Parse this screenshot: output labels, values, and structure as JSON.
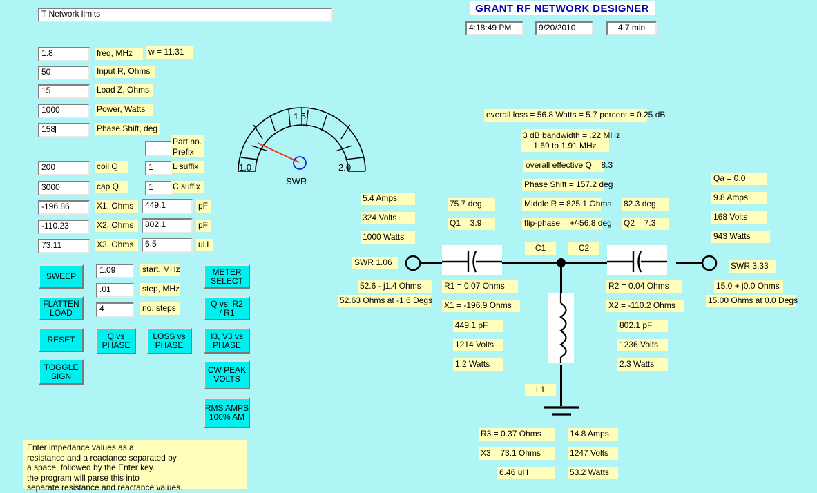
{
  "header": {
    "title": "GRANT RF NETWORK DESIGNER",
    "time": "4:18:49 PM",
    "date": "9/20/2010",
    "elapsed": "4.7 min"
  },
  "top_field": {
    "value": "T Network limits"
  },
  "inputs": [
    {
      "name": "freq",
      "value": "1.8",
      "label": "freq, MHz"
    },
    {
      "name": "input_r",
      "value": "50",
      "label": "Input R, Ohms"
    },
    {
      "name": "load_z",
      "value": "15",
      "label": "Load Z, Ohms"
    },
    {
      "name": "power",
      "value": "1000",
      "label": "Power, Watts"
    },
    {
      "name": "phase_shift",
      "value": "158",
      "label": "Phase Shift, deg"
    },
    {
      "name": "coil_q",
      "value": "200",
      "label": "coil Q"
    },
    {
      "name": "cap_q",
      "value": "3000",
      "label": "cap Q"
    },
    {
      "name": "x1",
      "value": "-196.86",
      "label": "X1, Ohms"
    },
    {
      "name": "x2",
      "value": "-110.23",
      "label": "X2, Ohms"
    },
    {
      "name": "x3",
      "value": "73.11",
      "label": "X3, Ohms"
    }
  ],
  "w_label": "w = 11.31",
  "part": {
    "prefix_value": "",
    "prefix_label": "Part no.\nPrefix",
    "l_suffix_value": "1",
    "l_suffix_label": "L suffix",
    "c_suffix_value": "1",
    "c_suffix_label": "C suffix"
  },
  "component_values": [
    {
      "name": "c1_pf",
      "value": "449.1",
      "unit": "pF"
    },
    {
      "name": "c2_pf",
      "value": "802.1",
      "unit": "pF"
    },
    {
      "name": "l1_uh",
      "value": "6.5",
      "unit": "uH"
    }
  ],
  "sweep": {
    "start_value": "1.09",
    "start_label": "start, MHz",
    "step_value": ".01",
    "step_label": "step, MHz",
    "steps_value": "4",
    "steps_label": "no. steps"
  },
  "buttons": {
    "sweep": "SWEEP",
    "flatten_load": "FLATTEN\nLOAD",
    "reset": "RESET",
    "toggle_sign": "TOGGLE\nSIGN",
    "q_vs_phase": "Q vs\nPHASE",
    "loss_vs_phase": "LOSS vs\nPHASE",
    "meter_select": "METER\nSELECT",
    "q_vs_r2_r1": "Q vs  R2\n/ R1",
    "i3_v3_vs_phase": "I3, V3 vs\nPHASE",
    "cw_peak_volts": "CW PEAK\nVOLTS",
    "rms_amps": "RMS AMPS\n100% AM"
  },
  "meter": {
    "label": "SWR",
    "tick_low": "1.0",
    "tick_mid": "1.5",
    "tick_high": "2.0",
    "needle_value": 1.03,
    "needle_color": "#ff3000",
    "hub_color": "#2020d0"
  },
  "results": {
    "overall_loss": "overall loss = 56.8 Watts = 5.7 percent = 0.25 dB",
    "bandwidth": "3 dB bandwidth = .22 MHz\n1.69 to 1.91 MHz",
    "effective_q": "overall effective Q = 8.3",
    "phase_shift": "Phase Shift = 157.2 deg",
    "middle_r": "Middle R = 825.1 Ohms",
    "flip_phase": "flip-phase = +/-56.8 deg"
  },
  "left_column": {
    "amps": "5.4 Amps",
    "volts": "324 Volts",
    "watts": "1000 Watts"
  },
  "q1_column": {
    "deg": "75.7 deg",
    "q": "Q1 = 3.9"
  },
  "q2_column": {
    "deg": "82.3 deg",
    "q": "Q2 = 7.3"
  },
  "qa_column": {
    "qa": "Qa = 0.0",
    "amps": "9.8 Amps",
    "volts": "168 Volts",
    "watts": "943 Watts"
  },
  "circuit": {
    "c1_tag": "C1",
    "c2_tag": "C2",
    "l1_tag": "L1",
    "input_swr": "SWR 1.06",
    "input_z": "52.6 - j1.4 Ohms",
    "input_z_polar": "52.63 Ohms at -1.6 Degs",
    "output_swr": "SWR 3.33",
    "output_z": "15.0 + j0.0 Ohms",
    "output_z_polar": "15.00 Ohms at 0.0 Degs",
    "c1_r": "R1 = 0.07 Ohms",
    "c1_x": "X1 = -196.9 Ohms",
    "c1_cap": "449.1 pF",
    "c1_volts": "1214 Volts",
    "c1_watts": "1.2 Watts",
    "c2_r": "R2 = 0.04 Ohms",
    "c2_x": "X2 = -110.2 Ohms",
    "c2_cap": "802.1 pF",
    "c2_volts": "1236 Volts",
    "c2_watts": "2.3 Watts",
    "l1_r": "R3 = 0.37 Ohms",
    "l1_x": "X3 = 73.1 Ohms",
    "l1_ind": "6.46 uH",
    "l1_amps": "14.8 Amps",
    "l1_volts": "1247 Volts",
    "l1_watts": "53.2 Watts"
  },
  "note": "Enter impedance values as a\nresistance and a reactance separated by\na space, followed by the Enter key.\nthe program will parse this into\nseparate resistance and reactance values."
}
